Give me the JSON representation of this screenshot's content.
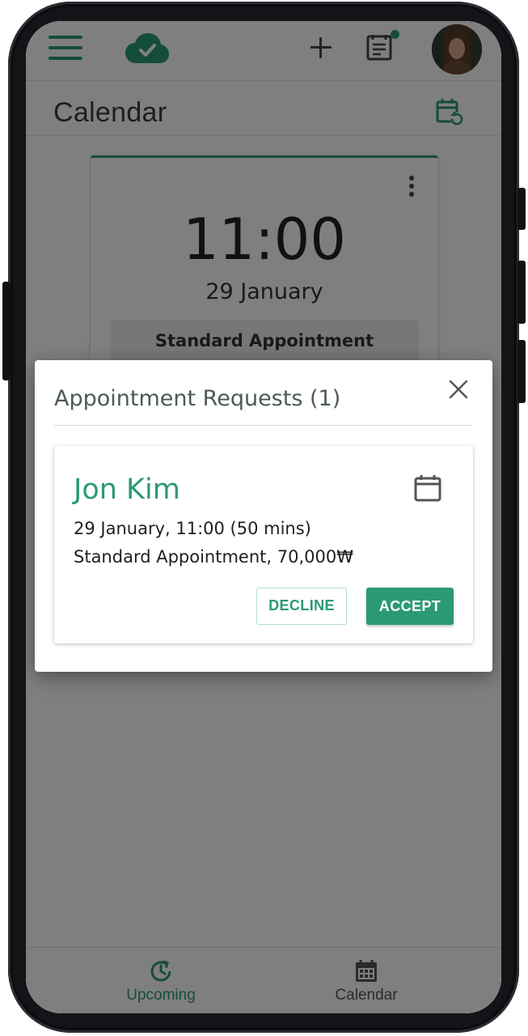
{
  "app_bar": {
    "menu_icon": "hamburger-menu-icon",
    "logo_icon": "cloud-check-icon",
    "add_icon": "plus-icon",
    "notes_icon": "notes-icon",
    "avatar_icon": "user-avatar"
  },
  "header": {
    "title": "Calendar",
    "action_icon": "calendar-refresh-icon"
  },
  "appointment": {
    "time": "11:00",
    "date": "29 January",
    "type": "Standard Appointment"
  },
  "dialog": {
    "title": "Appointment Requests (1)",
    "close_icon": "close-icon",
    "request": {
      "name": "Jon Kim",
      "details": "29 January, 11:00 (50 mins)",
      "service": "Standard Appointment, 70,000₩",
      "decline_label": "DECLINE",
      "accept_label": "ACCEPT"
    }
  },
  "bottom_nav": {
    "items": [
      {
        "label": "Upcoming",
        "icon": "upcoming-icon",
        "active": true
      },
      {
        "label": "Calendar",
        "icon": "calendar-grid-icon",
        "active": false
      }
    ]
  },
  "colors": {
    "accent": "#2b9a73",
    "scrim": "rgba(0,0,0,0.5)"
  }
}
